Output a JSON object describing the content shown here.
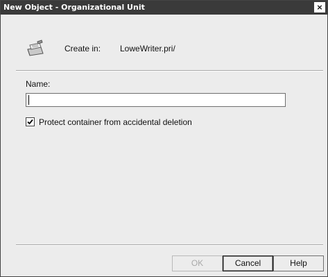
{
  "window": {
    "title": "New Object - Organizational Unit",
    "close_glyph": "×"
  },
  "header": {
    "icon": "organizational-unit-folder-icon",
    "create_in_label": "Create in:",
    "create_in_value": "LoweWriter.pri/"
  },
  "form": {
    "name_label": "Name:",
    "name_value": "",
    "protect_label": "Protect container from accidental deletion",
    "protect_checked": true
  },
  "buttons": {
    "ok": "OK",
    "cancel": "Cancel",
    "help": "Help"
  }
}
